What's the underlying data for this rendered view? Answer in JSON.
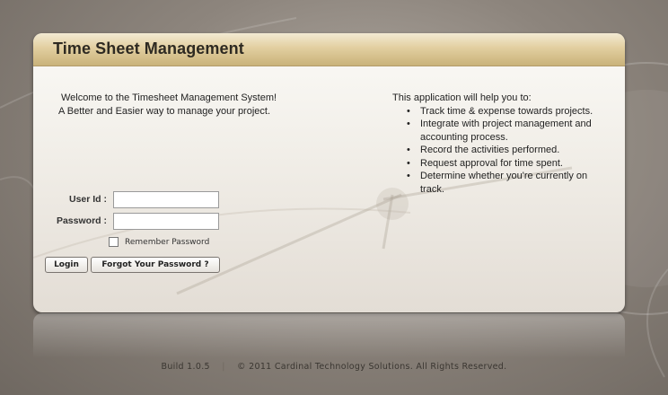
{
  "panel": {
    "title": "Time Sheet Management"
  },
  "welcome": {
    "line1": "Welcome to the Timesheet Management System!",
    "line2": "A Better and Easier way to manage your project."
  },
  "help": {
    "intro": "This application will help you to:",
    "items": [
      "Track time & expense towards projects.",
      "Integrate with project management and accounting process.",
      "Record the activities performed.",
      "Request approval for time spent.",
      "Determine whether you're currently on track."
    ]
  },
  "login_form": {
    "user_id_label": "User Id :",
    "user_id_value": "",
    "password_label": "Password :",
    "password_value": "",
    "remember_label": "Remember Password",
    "remember_checked": false,
    "login_label": "Login",
    "forgot_label": "Forgot Your Password ?"
  },
  "footer": {
    "build": "Build 1.0.5",
    "separator": "|",
    "copyright": "© 2011 Cardinal Technology Solutions. All Rights Reserved."
  },
  "colors": {
    "header_gold": "#d8c28e",
    "panel_bg": "#f4f1ec",
    "page_bg": "#8d857d"
  }
}
